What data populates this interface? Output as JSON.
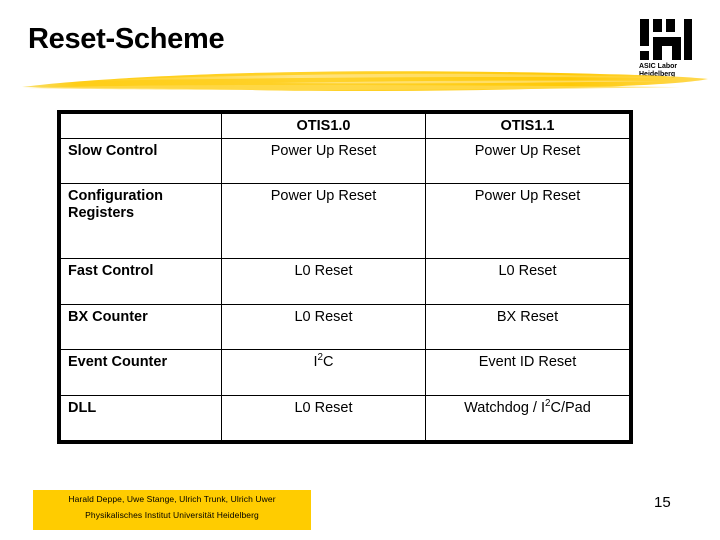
{
  "slide": {
    "title": "Reset-Scheme",
    "page_number": "15",
    "accent_color": "#FFCC00",
    "text_color": "#000000",
    "background_color": "#FFFFFF"
  },
  "logo": {
    "icon": "asic-labor-logo-icon",
    "line1": "ASIC Labor",
    "line2": "Heidelberg"
  },
  "divider": {
    "icon": "yellow-brush-stroke-icon",
    "color": "#FFCB0A"
  },
  "table": {
    "columns": [
      "",
      "OTIS1.0",
      "OTIS1.1"
    ],
    "rows": [
      {
        "label": "Slow Control",
        "otis10": "Power Up Reset",
        "otis11": "Power Up Reset"
      },
      {
        "label": "Configuration Registers",
        "otis10": "Power Up Reset",
        "otis11": "Power Up Reset"
      },
      {
        "label": "Fast Control",
        "otis10": "L0 Reset",
        "otis11": "L0 Reset"
      },
      {
        "label": "BX Counter",
        "otis10": "L0 Reset",
        "otis11": "BX Reset"
      },
      {
        "label": "Event Counter",
        "otis10": "I2C",
        "otis11": "Event ID Reset"
      },
      {
        "label": "DLL",
        "otis10": "L0 Reset",
        "otis11": "Watchdog / I2C/Pad"
      }
    ]
  },
  "footer": {
    "authors": "Harald Deppe, Uwe Stange, Ulrich Trunk, Ulrich Uwer",
    "institute": "Physikalisches Institut Universität Heidelberg"
  }
}
